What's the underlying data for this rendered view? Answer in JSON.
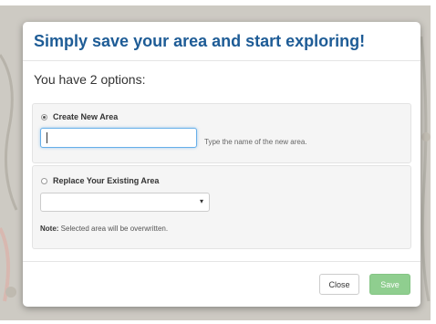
{
  "dialog": {
    "title": "Simply save your area and start exploring!",
    "options_heading": "You have 2 options:"
  },
  "option_new": {
    "label": "Create New Area",
    "selected": true,
    "input_value": "",
    "hint": "Type the name of the new area."
  },
  "option_replace": {
    "label": "Replace Your Existing Area",
    "selected": false,
    "selected_value": "",
    "note_label": "Note:",
    "note_text": " Selected area will be overwritten."
  },
  "footer": {
    "close_label": "Close",
    "save_label": "Save"
  },
  "icons": {
    "dropdown_arrow": "▾"
  },
  "colors": {
    "title": "#1e5c96",
    "save_button": "#8fce8f",
    "focus_border": "#66afe9"
  }
}
